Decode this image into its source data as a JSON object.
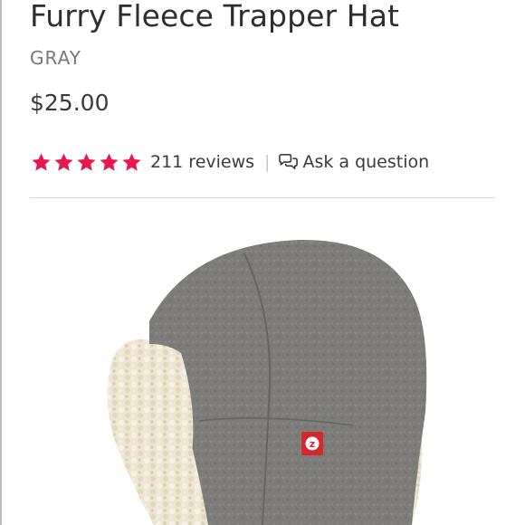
{
  "product": {
    "title": "Furry Fleece Trapper Hat",
    "color": "GRAY",
    "price": "$25.00",
    "rating": {
      "stars": 5,
      "max_stars": 5,
      "reviews_label": "211 reviews",
      "separator": "|",
      "ask_label": "Ask a question",
      "star_color": "#e8174f"
    },
    "image": {
      "logo_letter": "z"
    }
  },
  "colors": {
    "fleece_gray": "#7d7c79",
    "sherpa_cream": "#eee6d3",
    "tag_red": "#d8262e"
  }
}
